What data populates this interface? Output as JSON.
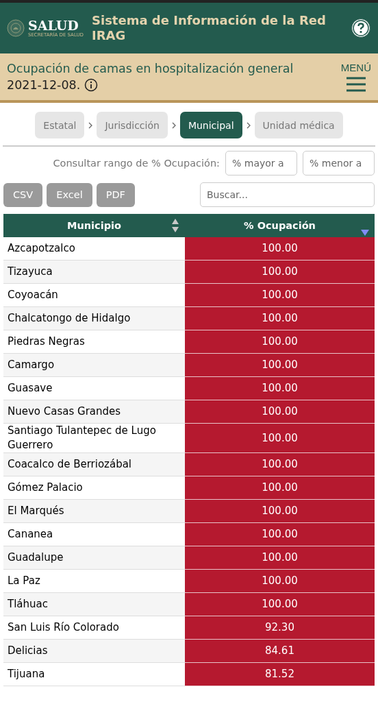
{
  "header": {
    "logo_text": "SALUD",
    "logo_subtext": "SECRETARÍA DE SALUD",
    "title": "Sistema de Información de la Red IRAG"
  },
  "subheader": {
    "title": "Ocupación de camas en hospitalización general",
    "date": "2021-12-08.",
    "menu_label": "MENÚ"
  },
  "tabs": [
    {
      "label": "Estatal",
      "selected": false
    },
    {
      "label": "Jurisdicción",
      "selected": false
    },
    {
      "label": "Municipal",
      "selected": true
    },
    {
      "label": "Unidad médica",
      "selected": false
    }
  ],
  "range_filter": {
    "label": "Consultar rango de % Ocupación:",
    "min_placeholder": "% mayor a",
    "max_placeholder": "% menor a"
  },
  "export_buttons": [
    "CSV",
    "Excel",
    "PDF"
  ],
  "search": {
    "placeholder": "Buscar..."
  },
  "table": {
    "columns": [
      {
        "label": "Municipio",
        "sorted": false
      },
      {
        "label": "% Ocupación",
        "sorted": true
      }
    ],
    "rows": [
      [
        "Azcapotzalco",
        "100.00"
      ],
      [
        "Tizayuca",
        "100.00"
      ],
      [
        "Coyoacán",
        "100.00"
      ],
      [
        "Chalcatongo de Hidalgo",
        "100.00"
      ],
      [
        "Piedras Negras",
        "100.00"
      ],
      [
        "Camargo",
        "100.00"
      ],
      [
        "Guasave",
        "100.00"
      ],
      [
        "Nuevo Casas Grandes",
        "100.00"
      ],
      [
        "Santiago Tulantepec de Lugo Guerrero",
        "100.00"
      ],
      [
        "Coacalco de Berriozábal",
        "100.00"
      ],
      [
        "Gómez Palacio",
        "100.00"
      ],
      [
        "El Marqués",
        "100.00"
      ],
      [
        "Cananea",
        "100.00"
      ],
      [
        "Guadalupe",
        "100.00"
      ],
      [
        "La Paz",
        "100.00"
      ],
      [
        "Tláhuac",
        "100.00"
      ],
      [
        "San Luis Río Colorado",
        "92.30"
      ],
      [
        "Delicias",
        "84.61"
      ],
      [
        "Tijuana",
        "81.52"
      ]
    ]
  }
}
